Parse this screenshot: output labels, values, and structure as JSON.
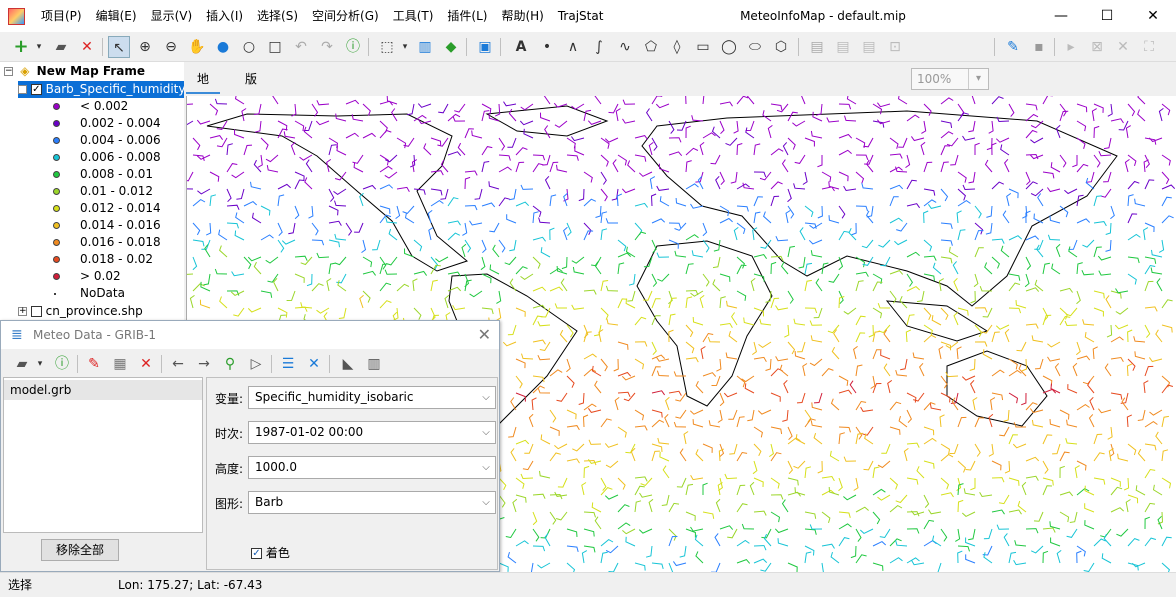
{
  "window": {
    "title": "MeteoInfoMap - default.mip",
    "min": "—",
    "max": "☐",
    "close": "✕"
  },
  "menu": [
    "项目(P)",
    "编辑(E)",
    "显示(V)",
    "插入(I)",
    "选择(S)",
    "空间分析(G)",
    "工具(T)",
    "插件(L)",
    "帮助(H)",
    "TrajStat"
  ],
  "toolbar": {
    "zoom": "100%"
  },
  "legend": {
    "frame": "New Map Frame",
    "layer": "Barb_Specific_humidity",
    "layer2": "cn_province.shp",
    "items": [
      {
        "label": "< 0.002",
        "color": "#9b00c8"
      },
      {
        "label": "0.002 - 0.004",
        "color": "#6a00c8"
      },
      {
        "label": "0.004 - 0.006",
        "color": "#2a7fff"
      },
      {
        "label": "0.006 - 0.008",
        "color": "#17c4d6"
      },
      {
        "label": "0.008 - 0.01",
        "color": "#20c840"
      },
      {
        "label": "0.01 - 0.012",
        "color": "#9bd62a"
      },
      {
        "label": "0.012 - 0.014",
        "color": "#d6e01a"
      },
      {
        "label": "0.014 - 0.016",
        "color": "#f0c020"
      },
      {
        "label": "0.016 - 0.018",
        "color": "#f08a20"
      },
      {
        "label": "0.018 - 0.02",
        "color": "#e64a20"
      },
      {
        "label": "> 0.02",
        "color": "#d01e3a"
      },
      {
        "label": "NoData",
        "color": "#000000"
      }
    ]
  },
  "map_tabs": [
    "地图",
    "版面"
  ],
  "dialog": {
    "title": "Meteo Data - GRIB-1",
    "file": "model.grb",
    "remove_all": "移除全部",
    "var_label": "变量:",
    "var_value": "Specific_humidity_isobaric",
    "time_label": "时次:",
    "time_value": "1987-01-02 00:00",
    "level_label": "高度:",
    "level_value": "1000.0",
    "graph_label": "图形:",
    "graph_value": "Barb",
    "color_label": "着色"
  },
  "status": {
    "mode": "选择",
    "coords": "Lon: 175.27; Lat: -67.43"
  }
}
